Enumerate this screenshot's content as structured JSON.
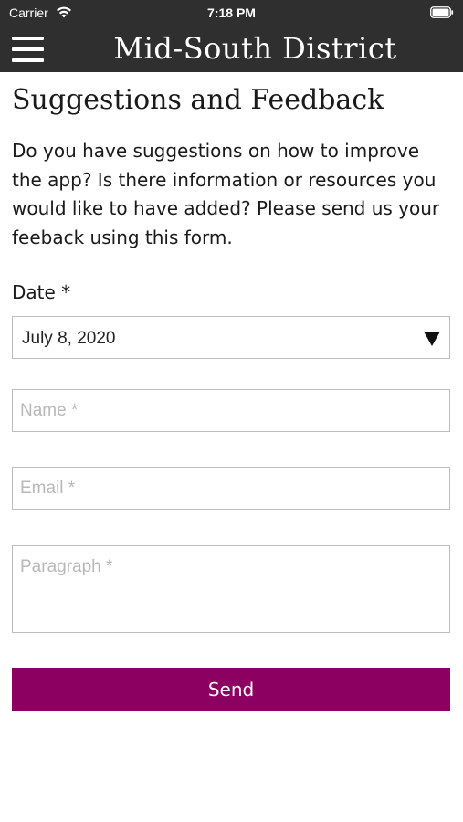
{
  "status_bar": {
    "carrier": "Carrier",
    "time": "7:18 PM",
    "wifi_icon": "wifi-icon",
    "battery_icon": "battery-icon"
  },
  "header": {
    "title": "Mid-South District",
    "menu_icon": "hamburger-menu-icon",
    "background_color": "#2f2f2f"
  },
  "page": {
    "title": "Suggestions and Feedback",
    "intro": "Do you have suggestions on how to improve the app? Is there information or resources you would like to have added? Please send us your feeback using this form."
  },
  "form": {
    "date_label": "Date *",
    "date_value": "July 8, 2020",
    "name_placeholder": "Name *",
    "email_placeholder": "Email *",
    "paragraph_placeholder": "Paragraph *",
    "send_label": "Send",
    "send_color": "#8b0060"
  }
}
